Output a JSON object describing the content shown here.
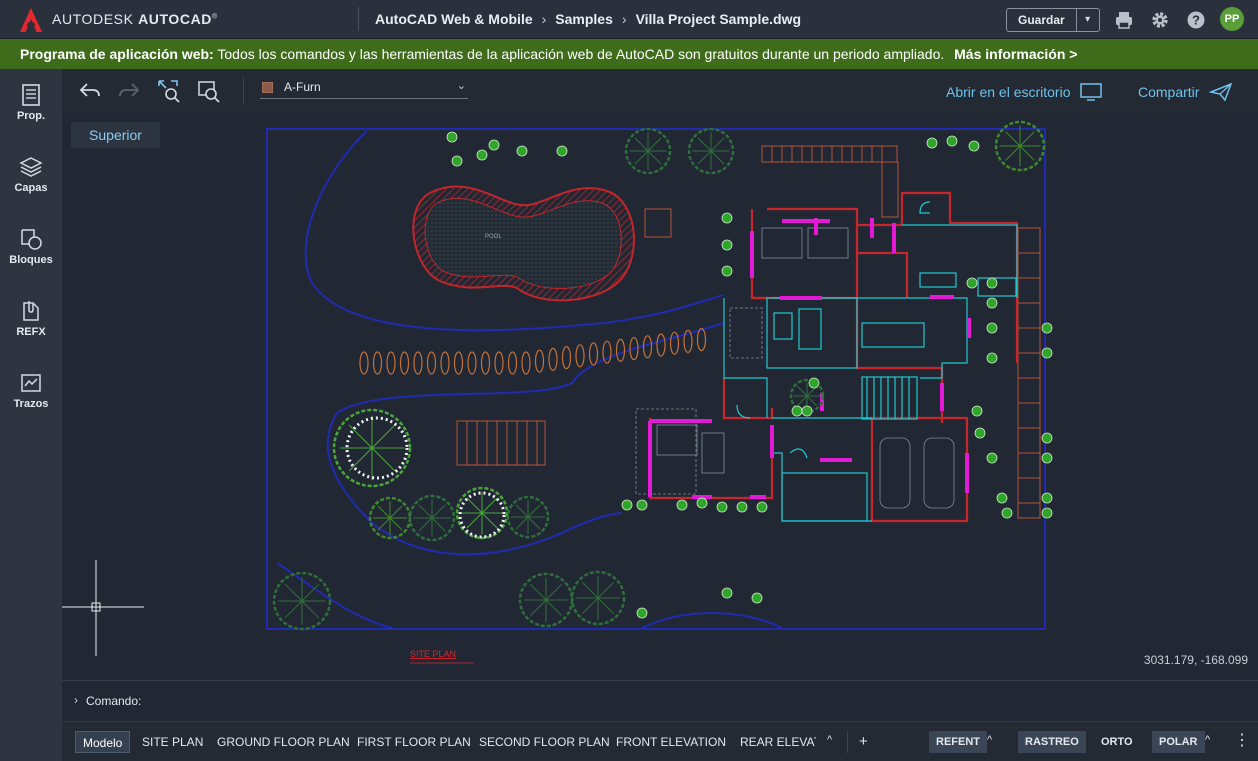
{
  "header": {
    "brand_prefix": "AUTODESK",
    "brand_product": "AUTOCAD",
    "breadcrumb": [
      "AutoCAD Web & Mobile",
      "Samples",
      "Villa Project Sample.dwg"
    ],
    "save_label": "Guardar",
    "avatar_initials": "PP",
    "icons": [
      "print-icon",
      "gear-icon",
      "help-icon"
    ]
  },
  "banner": {
    "bold_text": "Programa de aplicación web:",
    "text": "Todos los comandos y las herramientas de la aplicación web de AutoCAD son gratuitos durante un periodo ampliado.",
    "link_text": "Más información >",
    "color": "#3f6c1b"
  },
  "sidebar": {
    "items": [
      {
        "label": "Prop.",
        "icon": "properties-icon"
      },
      {
        "label": "Capas",
        "icon": "layers-icon"
      },
      {
        "label": "Bloques",
        "icon": "blocks-icon"
      },
      {
        "label": "REFX",
        "icon": "xref-icon"
      },
      {
        "label": "Trazos",
        "icon": "traces-icon"
      }
    ]
  },
  "toolbar": {
    "layer_name": "A-Furn",
    "layer_color": "#8b5a48",
    "open_desktop_label": "Abrir en el escritorio",
    "share_label": "Compartir",
    "accent": "#6fc1ea"
  },
  "canvas": {
    "view_label": "Superior",
    "coordinates": "3031.179, -168.099",
    "drawing_labels": {
      "site_plan_title": "SITE PLAN",
      "pool_label": "POOL"
    }
  },
  "command": {
    "label": "Comando:"
  },
  "statusbar": {
    "tabs": [
      "Modelo",
      "SITE PLAN",
      "GROUND FLOOR PLAN",
      "FIRST FLOOR PLAN",
      "SECOND FLOOR PLAN",
      "FRONT  ELEVATION",
      "REAR  ELEVAT"
    ],
    "active_tab": "Modelo",
    "add_tab": "+",
    "toggles": [
      {
        "label": "REFENT",
        "on": true
      },
      {
        "label": "RASTREO",
        "on": true
      },
      {
        "label": "ORTO",
        "on": false
      },
      {
        "label": "POLAR",
        "on": true
      }
    ]
  }
}
